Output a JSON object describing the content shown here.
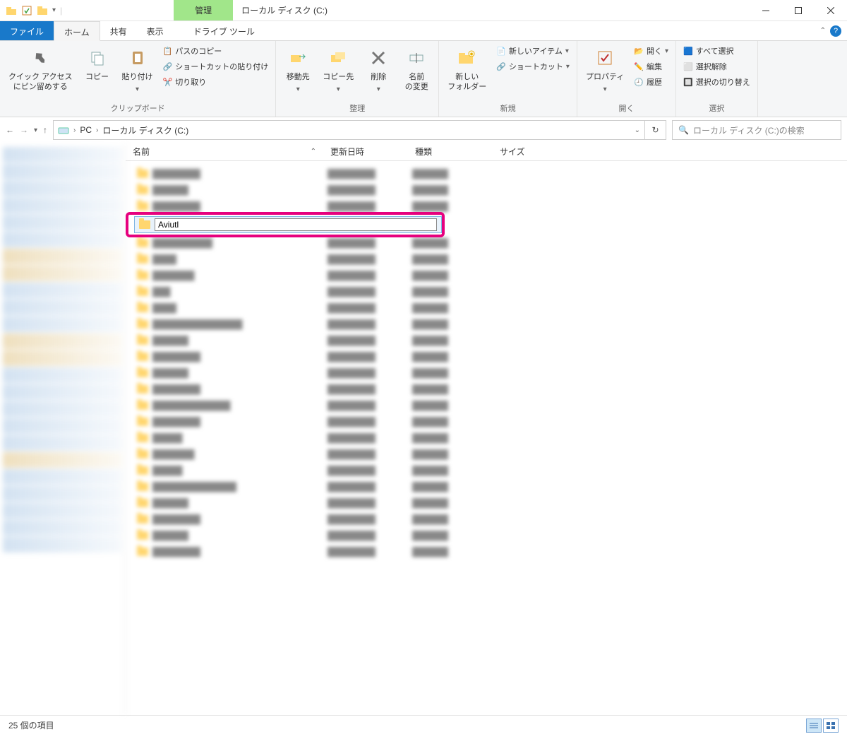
{
  "window": {
    "title": "ローカル ディスク (C:)",
    "manage_tab": "管理"
  },
  "tabs": {
    "file": "ファイル",
    "home": "ホーム",
    "share": "共有",
    "view": "表示",
    "drive_tools": "ドライブ ツール"
  },
  "ribbon": {
    "clipboard": {
      "pin": "クイック アクセス\nにピン留めする",
      "copy": "コピー",
      "paste": "貼り付け",
      "path_copy": "パスのコピー",
      "shortcut_paste": "ショートカットの貼り付け",
      "cut": "切り取り",
      "group": "クリップボード"
    },
    "organize": {
      "move_to": "移動先",
      "copy_to": "コピー先",
      "delete": "削除",
      "rename": "名前\nの変更",
      "group": "整理"
    },
    "new": {
      "new_folder": "新しい\nフォルダー",
      "new_item": "新しいアイテム",
      "shortcut": "ショートカット",
      "group": "新規"
    },
    "open": {
      "properties": "プロパティ",
      "open": "開く",
      "edit": "編集",
      "history": "履歴",
      "group": "開く"
    },
    "select": {
      "select_all": "すべて選択",
      "select_none": "選択解除",
      "invert": "選択の切り替え",
      "group": "選択"
    }
  },
  "address": {
    "pc": "PC",
    "drive": "ローカル ディスク (C:)"
  },
  "search": {
    "placeholder": "ローカル ディスク (C:)の検索"
  },
  "columns": {
    "name": "名前",
    "date": "更新日時",
    "type": "種類",
    "size": "サイズ"
  },
  "rename": {
    "value": "Aviutl"
  },
  "status": {
    "count": "25 個の項目"
  }
}
